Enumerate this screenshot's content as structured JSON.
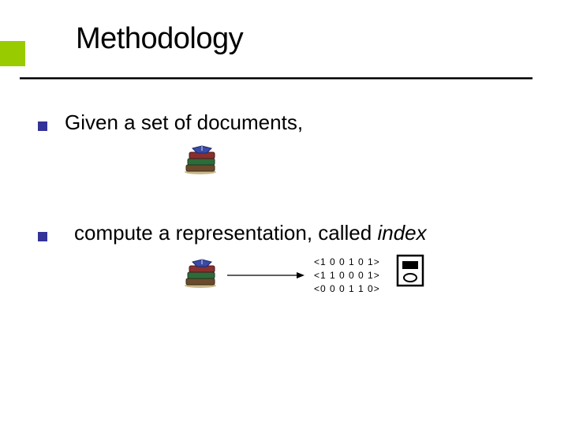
{
  "title": "Methodology",
  "bullets": [
    {
      "text": "Given a set of documents,"
    },
    {
      "text_prefix": "compute a representation, called ",
      "text_italic": "index"
    }
  ],
  "vectors": {
    "line1": "<1 0 0 1 0 1>",
    "line2": "<1 1 0 0 0 1>",
    "line3": "<0 0 0 1 1 0>"
  },
  "icons": {
    "books": "books-icon",
    "arrow": "arrow-icon",
    "database": "database-icon"
  }
}
